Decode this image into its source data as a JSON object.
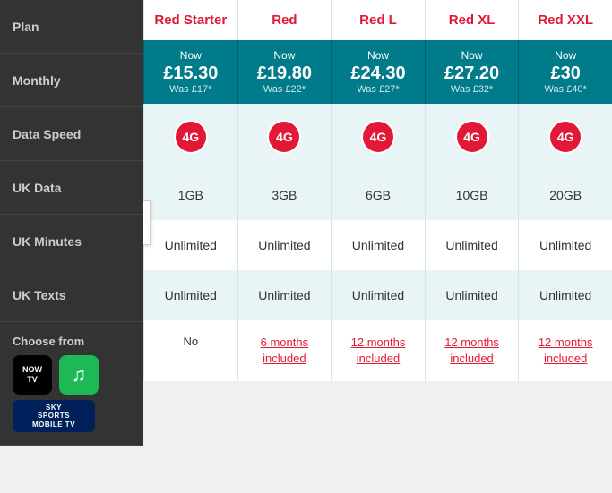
{
  "sidebar": {
    "items": [
      {
        "label": "Plan"
      },
      {
        "label": "Monthly"
      },
      {
        "label": "Data Speed"
      },
      {
        "label": "UK Data"
      },
      {
        "label": "UK Minutes"
      },
      {
        "label": "UK Texts"
      },
      {
        "label": "Choose from"
      }
    ]
  },
  "plans": [
    {
      "name": "Red Starter",
      "price_now": "£15.30",
      "price_was": "Was £17*",
      "data": "1GB",
      "minutes": "Unlimited",
      "texts": "Unlimited",
      "bonus": "No",
      "bonus_is_link": false
    },
    {
      "name": "Red",
      "price_now": "£19.80",
      "price_was": "Was £22*",
      "data": "3GB",
      "minutes": "Unlimited",
      "texts": "Unlimited",
      "bonus": "6 months included",
      "bonus_is_link": true
    },
    {
      "name": "Red L",
      "price_now": "£24.30",
      "price_was": "Was £27*",
      "data": "6GB",
      "minutes": "Unlimited",
      "texts": "Unlimited",
      "bonus": "12 months included",
      "bonus_is_link": true
    },
    {
      "name": "Red XL",
      "price_now": "£27.20",
      "price_was": "Was £32*",
      "data": "10GB",
      "minutes": "Unlimited",
      "texts": "Unlimited",
      "bonus": "12 months included",
      "bonus_is_link": true
    },
    {
      "name": "Red XXL",
      "price_now": "£30",
      "price_was": "Was £40*",
      "data": "20GB",
      "minutes": "Unlimited",
      "texts": "Unlimited",
      "bonus": "12 months included",
      "bonus_is_link": true
    }
  ],
  "nav": {
    "arrow": "‹"
  },
  "logos": {
    "nowtv": "NOW\nTV",
    "spotify": "🎵",
    "sky": "SKY SPORTS MOBILE TV"
  }
}
